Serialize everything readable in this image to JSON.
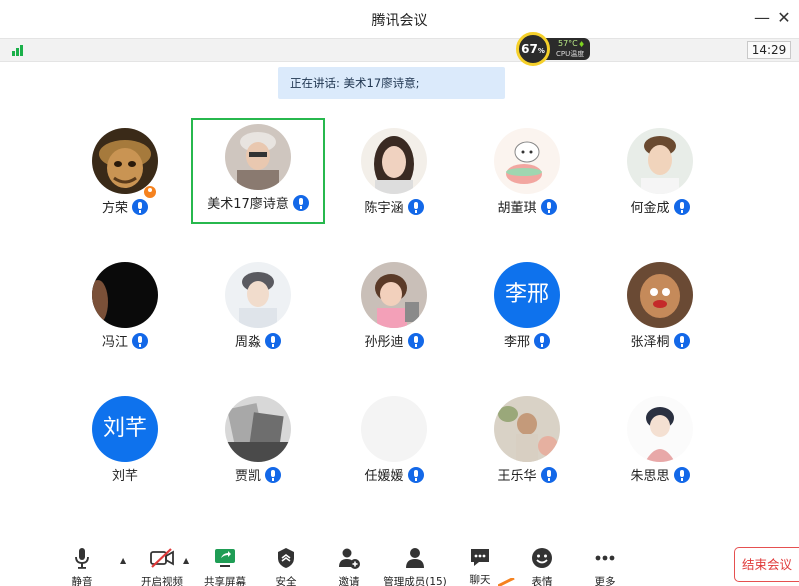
{
  "window": {
    "title": "腾讯会议",
    "minimize": "—",
    "close": "✕"
  },
  "status": {
    "time": "14:29"
  },
  "cpu": {
    "percent": "67",
    "percent_unit": "%",
    "temp": "57°C",
    "temp_label": "CPU温度"
  },
  "speaking": {
    "text": "正在讲话: 美术17廖诗意;"
  },
  "participants": [
    {
      "name": "方荣",
      "host": true
    },
    {
      "name": "美术17廖诗意",
      "active": true
    },
    {
      "name": "陈宇涵"
    },
    {
      "name": "胡董琪"
    },
    {
      "name": "何金成"
    },
    {
      "name": "冯江"
    },
    {
      "name": "周淼"
    },
    {
      "name": "孙彤迪"
    },
    {
      "name": "李邢",
      "avatar_text": "李邢"
    },
    {
      "name": "张泽桐"
    },
    {
      "name": "刘芊",
      "avatar_text": "刘芊"
    },
    {
      "name": "贾凯"
    },
    {
      "name": "任媛媛"
    },
    {
      "name": "王乐华"
    },
    {
      "name": "朱思思"
    }
  ],
  "toolbar": {
    "mute": "静音",
    "video": "开启视频",
    "share": "共享屏幕",
    "security": "安全",
    "invite": "邀请",
    "members": "管理成员(15)",
    "chat": "聊天",
    "emoji": "表情",
    "more": "更多",
    "end": "结束会议"
  },
  "colors": {
    "accent": "#1368e8",
    "active_border": "#27b84d",
    "end_red": "#e03a3a",
    "avatar_blue": "#0e72ed"
  }
}
